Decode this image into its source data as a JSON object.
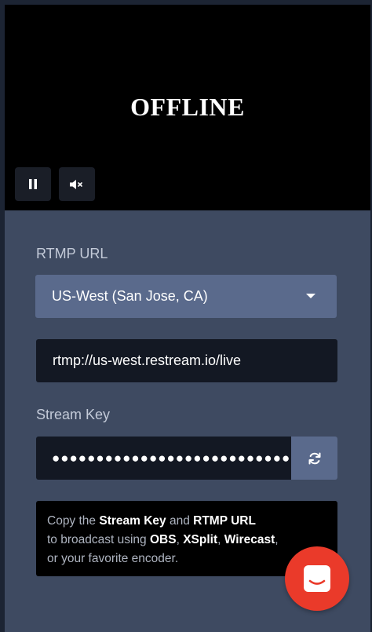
{
  "video": {
    "status": "OFFLINE",
    "pause_icon": "pause-icon",
    "mute_icon": "volume-mute-icon"
  },
  "rtmp": {
    "label": "RTMP URL",
    "selected_server": "US-West (San Jose, CA)",
    "url": "rtmp://us-west.restream.io/live"
  },
  "stream_key": {
    "label": "Stream Key",
    "masked_value": "●●●●●●●●●●●●●●●●●●●●●●●●●●●●●●",
    "refresh_icon": "refresh-icon"
  },
  "info": {
    "p1": "Copy the ",
    "k1": "Stream Key",
    "p2": " and ",
    "k2": "RTMP URL",
    "p3": "to broadcast using ",
    "k3": "OBS",
    "p4": ", ",
    "k4": "XSplit",
    "p5": ", ",
    "k5": "Wirecast",
    "p6": ",",
    "p7": "or your favorite encoder."
  },
  "chat": {
    "icon": "chat-icon"
  },
  "colors": {
    "panel": "#3e4a61",
    "accent": "#5a6a8c",
    "input_bg": "#131823",
    "chat_bubble": "#ea3a2a"
  }
}
